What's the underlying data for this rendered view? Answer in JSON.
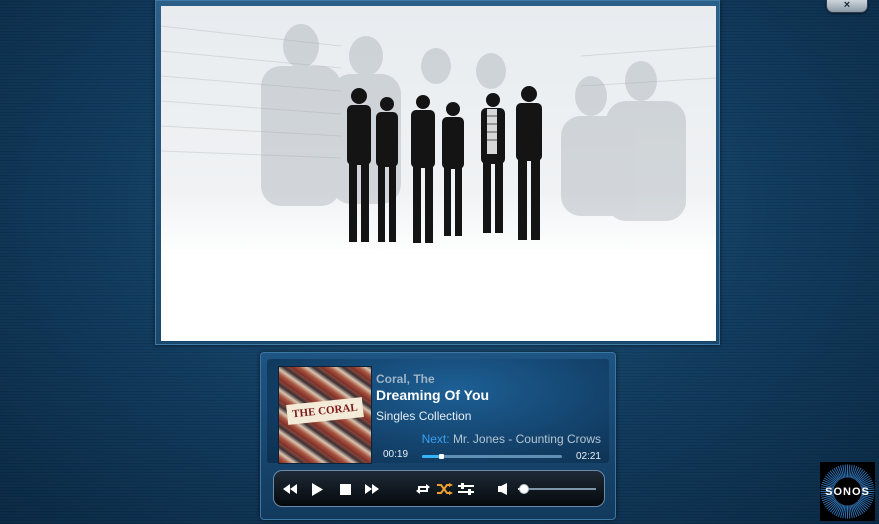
{
  "window": {
    "close_label": "×"
  },
  "now_playing": {
    "artist": "Coral, The",
    "track": "Dreaming Of You",
    "album": "Singles Collection",
    "album_art_logo": "THE CORAL",
    "next_label": "Next:",
    "next_track": "Mr. Jones - Counting Crows",
    "elapsed": "00:19",
    "total": "02:21",
    "progress_fraction": 0.134
  },
  "controls": {
    "buttons": [
      "rewind-icon",
      "play-icon",
      "stop-icon",
      "fast-forward-icon",
      "repeat-icon",
      "shuffle-icon",
      "crossfade-icon",
      "volume-icon"
    ],
    "volume_fraction": 0.04
  },
  "branding": {
    "logo_text": "SONOS"
  },
  "colors": {
    "accent": "#35b4ff",
    "next_label": "#3aa0f0",
    "shuffle_active": "#f0a030"
  }
}
